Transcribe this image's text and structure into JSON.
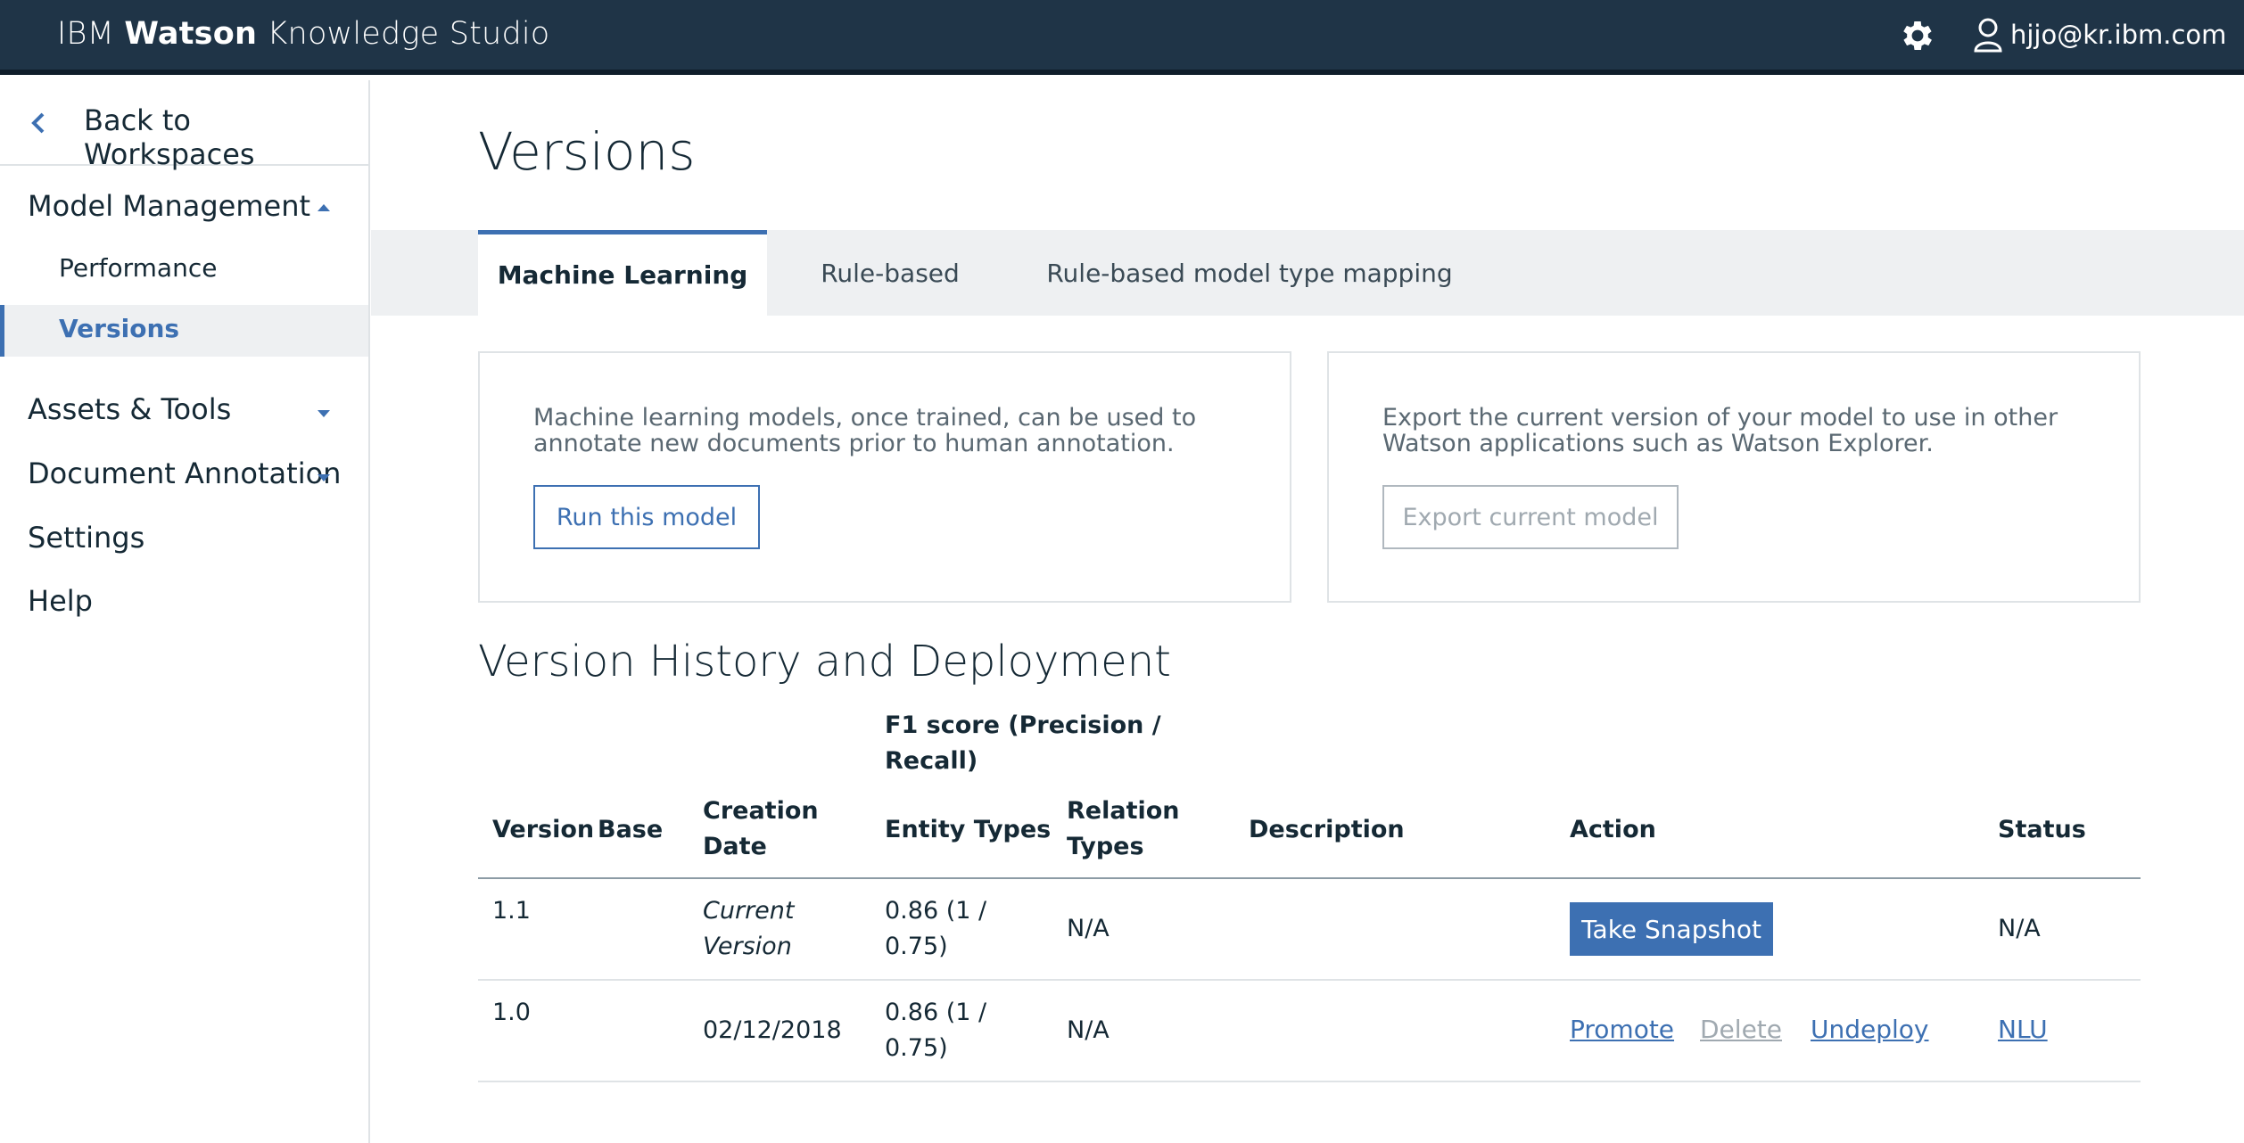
{
  "header": {
    "brand_part1": "IBM",
    "brand_part2": "Watson",
    "brand_part3": "Knowledge Studio",
    "settings_icon": "gear-icon",
    "user_icon": "user-icon",
    "user_email": "hjjo@kr.ibm.com",
    "bg_color": "#1f3447"
  },
  "sidebar": {
    "back_label": "Back to Workspaces",
    "model_management": "Model Management",
    "sub_items": [
      {
        "label": "Performance",
        "active": false
      },
      {
        "label": "Versions",
        "active": true
      }
    ],
    "assets_tools": "Assets & Tools",
    "document_annotation": "Document Annotation",
    "settings": "Settings",
    "help": "Help"
  },
  "main": {
    "title": "Versions",
    "tabs": [
      {
        "label": "Machine Learning",
        "active": true
      },
      {
        "label": "Rule-based",
        "active": false
      },
      {
        "label": "Rule-based model type mapping",
        "active": false
      }
    ],
    "card_run": {
      "line1": "Machine learning models, once trained, can be used to",
      "line2": "annotate new documents prior to human annotation.",
      "button": "Run this model"
    },
    "card_export": {
      "line1": "Export the current version of your model to use in other",
      "line2": "Watson applications such as Watson Explorer.",
      "button": "Export current model"
    },
    "history_title": "Version History and Deployment",
    "table": {
      "headers": {
        "version": "Version",
        "base": "Base",
        "creation_date_1": "Creation",
        "creation_date_2": "Date",
        "f1_1": "F1 score (Precision /",
        "f1_2": "Recall)",
        "entity_types": "Entity Types",
        "relation_types_1": "Relation",
        "relation_types_2": "Types",
        "description": "Description",
        "action": "Action",
        "status": "Status"
      },
      "rows": [
        {
          "version": "1.1",
          "base": "",
          "creation_1": "Current",
          "creation_2": "Version",
          "entity_1": "0.86 (1 /",
          "entity_2": "0.75)",
          "relation": "N/A",
          "description": "",
          "action_button": "Take Snapshot",
          "status": "N/A"
        },
        {
          "version": "1.0",
          "base": "",
          "creation": "02/12/2018",
          "entity_1": "0.86 (1 /",
          "entity_2": "0.75)",
          "relation": "N/A",
          "description": "",
          "action_promote": "Promote",
          "action_delete": "Delete",
          "action_undeploy": "Undeploy",
          "status": "NLU"
        }
      ]
    }
  },
  "colors": {
    "accent": "#3d70b2",
    "text": "#152935",
    "muted": "#5a6872",
    "disabled": "#a0a9b0"
  }
}
